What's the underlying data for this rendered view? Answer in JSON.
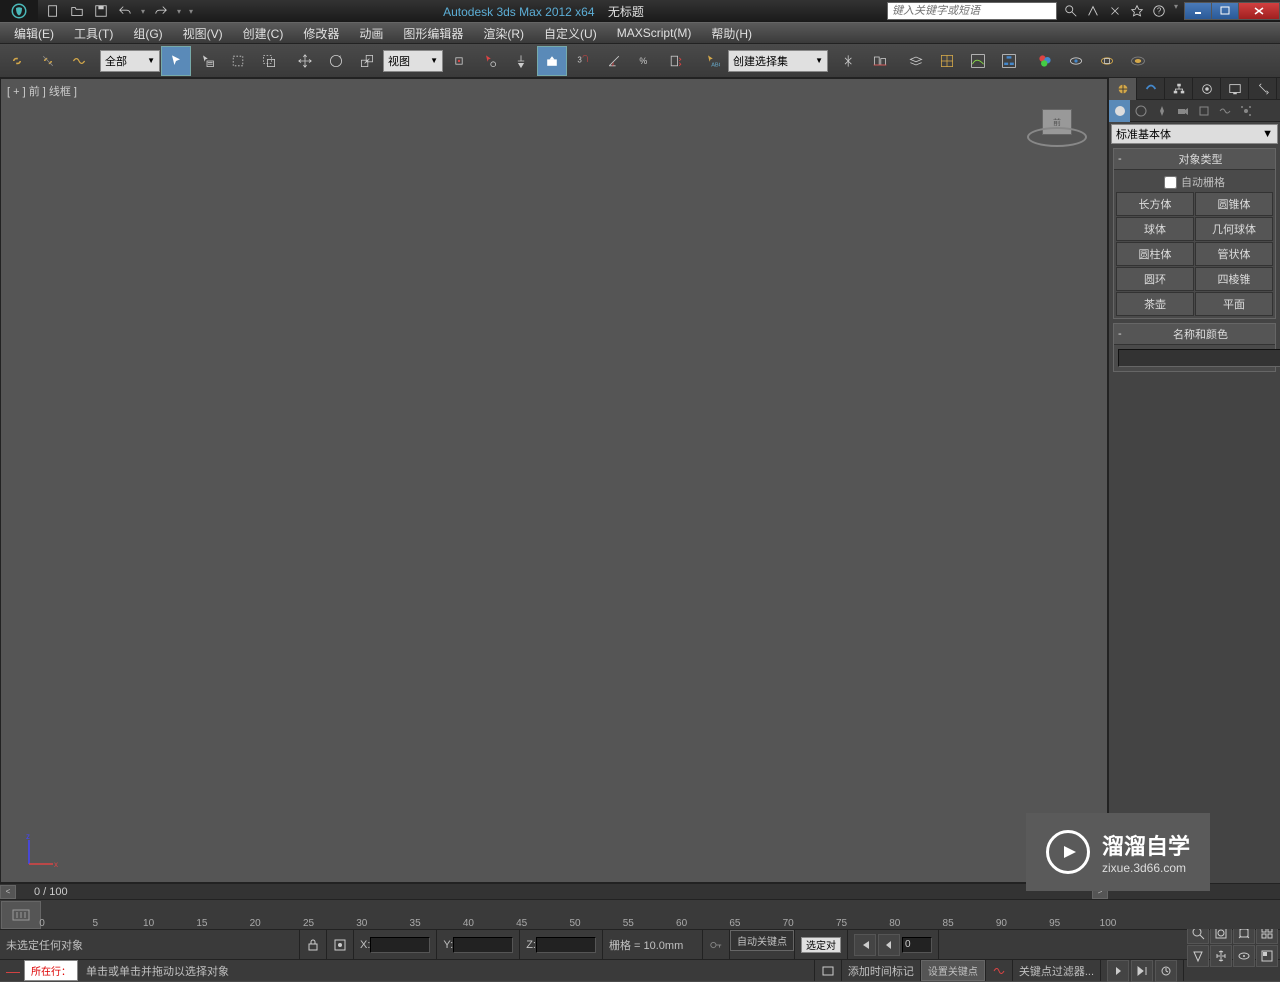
{
  "titlebar": {
    "app_name": "Autodesk 3ds Max  2012 x64",
    "doc_title": "无标题",
    "search_placeholder": "键入关键字或短语"
  },
  "menu": {
    "edit": "编辑(E)",
    "tools": "工具(T)",
    "group": "组(G)",
    "views": "视图(V)",
    "create": "创建(C)",
    "modifiers": "修改器",
    "animation": "动画",
    "graph_editors": "图形编辑器",
    "rendering": "渲染(R)",
    "customize": "自定义(U)",
    "maxscript": "MAXScript(M)",
    "help": "帮助(H)"
  },
  "toolbar": {
    "filter_combo": "全部",
    "coord_combo": "视图",
    "selection_set_combo": "创建选择集"
  },
  "viewport": {
    "label": "[ + ] 前 ] 线框 ]",
    "cube_face": "前"
  },
  "command_panel": {
    "category_combo": "标准基本体",
    "rollout_object_type": "对象类型",
    "auto_grid": "自动栅格",
    "primitives": {
      "box": "长方体",
      "cone": "圆锥体",
      "sphere": "球体",
      "geosphere": "几何球体",
      "cylinder": "圆柱体",
      "tube": "管状体",
      "torus": "圆环",
      "pyramid": "四棱锥",
      "teapot": "茶壶",
      "plane": "平面"
    },
    "rollout_name_color": "名称和颜色"
  },
  "timeline": {
    "frame_display": "0 / 100",
    "ticks": [
      "0",
      "5",
      "10",
      "15",
      "20",
      "25",
      "30",
      "35",
      "40",
      "45",
      "50",
      "55",
      "60",
      "65",
      "70",
      "75",
      "80",
      "85",
      "90",
      "95",
      "100"
    ]
  },
  "statusbar": {
    "selection_status": "未选定任何对象",
    "x_label": "X:",
    "y_label": "Y:",
    "z_label": "Z:",
    "grid_label": "栅格 = 10.0mm",
    "auto_key": "自动关键点",
    "set_key": "设置关键点",
    "selected_combo": "选定对",
    "key_filters": "关键点过滤器...",
    "frame_input": "0",
    "add_time_tag": "添加时间标记",
    "prompt": "单击或单击并拖动以选择对象",
    "macro_label": "所在行："
  },
  "watermark": {
    "text_big": "溜溜自学",
    "text_small": "zixue.3d66.com"
  }
}
